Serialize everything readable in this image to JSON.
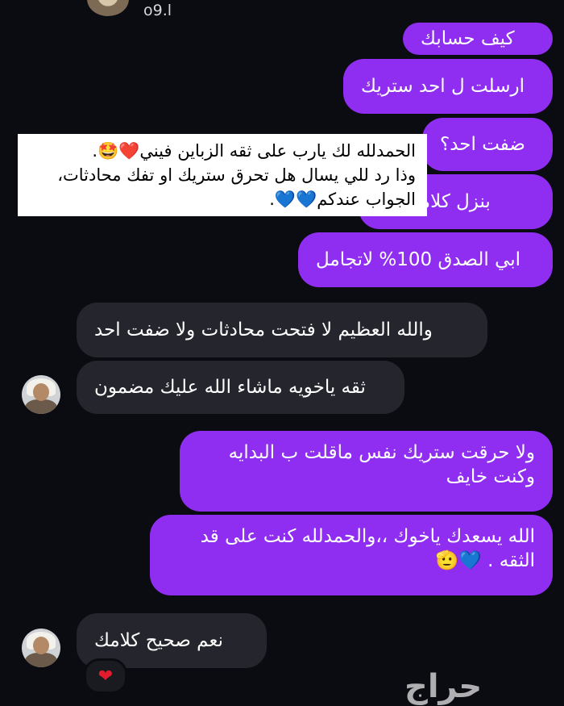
{
  "header": {
    "username": "o9.l"
  },
  "messages": [
    {
      "id": "m1",
      "text": "كيف حسابك"
    },
    {
      "id": "m2",
      "text": "ارسلت ل احد ستريك"
    },
    {
      "id": "m3",
      "text": "ضفت احد؟"
    },
    {
      "id": "m4",
      "text": "بنزل كلامك س"
    },
    {
      "id": "m5",
      "text": "ابي الصدق 100% لاتجامل"
    },
    {
      "id": "m6",
      "text": "والله العظيم لا فتحت محادثات ولا ضفت احد"
    },
    {
      "id": "m7",
      "text": "ثقه ياخويه ماشاء الله عليك مضمون"
    },
    {
      "id": "m8_l1",
      "text": "ولا حرقت ستريك نفس ماقلت ب البدايه"
    },
    {
      "id": "m8_l2",
      "text": "وكنت خايف"
    },
    {
      "id": "m9_l1",
      "text": "الله يسعدك ياخوك ،،والحمدلله كنت على قد"
    },
    {
      "id": "m9_l2",
      "text": "الثقه . 💙🫡"
    },
    {
      "id": "m10",
      "text": "نعم  صحيح كلامك"
    }
  ],
  "overlay_note": {
    "line1": "الحمدلله لك يارب على ثقه الزباين فيني❤️🤩.",
    "line2": "وذا رد للي يسال هل تحرق ستريك او تفك محادثات،",
    "line3": "الجواب عندكم💙💙."
  },
  "reaction": "❤",
  "watermark": "حراج",
  "colors": {
    "background": "#0b0b12",
    "outgoing_bubble": "#8f2ef0",
    "incoming_bubble": "#25262d"
  },
  "icons": [
    "back-arrow-icon",
    "video-call-icon",
    "voice-call-icon",
    "info-icon",
    "flag-icon"
  ]
}
